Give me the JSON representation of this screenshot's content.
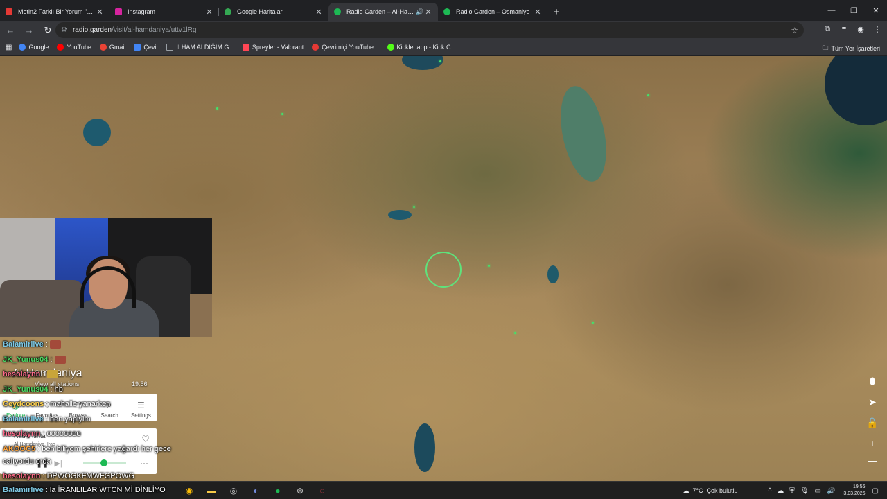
{
  "tabs": [
    {
      "title": "Metin2 Farklı Bir Yorum \"Hadi G",
      "favicon_color": "#e53935",
      "active": false
    },
    {
      "title": "Instagram",
      "favicon_color": "#d6249f",
      "active": false
    },
    {
      "title": "Google Haritalar",
      "favicon_color": "#34a853",
      "active": false
    },
    {
      "title": "Radio Garden – Al-Hamdan",
      "favicon_color": "#1db954",
      "active": true
    },
    {
      "title": "Radio Garden – Osmaniye",
      "favicon_color": "#1db954",
      "active": false
    }
  ],
  "address": {
    "host": "radio.garden",
    "path": "/visit/al-hamdaniya/uttv1lRg"
  },
  "bookmarks": [
    {
      "label": "Google",
      "color": "#4285f4"
    },
    {
      "label": "YouTube",
      "color": "#ff0000"
    },
    {
      "label": "Gmail",
      "color": "#ea4335"
    },
    {
      "label": "Çevir",
      "color": "#4285f4"
    },
    {
      "label": "İLHAM ALDIĞIM G...",
      "color": "#9aa0a6"
    },
    {
      "label": "Spreyler - Valorant",
      "color": "#ff4655"
    },
    {
      "label": "Çevrimiçi YouTube...",
      "color": "#e53935"
    },
    {
      "label": "Kicklet.app - Kick C...",
      "color": "#53fc18"
    }
  ],
  "bookmarks_right": "Tüm Yer İşaretleri",
  "radio": {
    "station_title": "Al-Hamdaniya",
    "view_all": "View all stations",
    "time": "19:56",
    "nav": [
      "Explore",
      "Favorites",
      "Browse",
      "Search",
      "Settings"
    ],
    "now_playing_station": "Radio Ishtar",
    "now_playing_location": "Al-Hamdaniya, Iraq"
  },
  "chat": [
    {
      "user": "Balamirlive",
      "color": "#7ec8e3",
      "msg": ":",
      "emote": true
    },
    {
      "user": "JK_Yunus04",
      "color": "#4cd964",
      "msg": ":",
      "emote": true
    },
    {
      "user": "hesolaynn",
      "color": "#ff6b8b",
      "msg": ":",
      "emote": true
    },
    {
      "user": "JK_Yunus04",
      "color": "#4cd964",
      "msg": ": hb",
      "emote": false
    },
    {
      "user": "Ceydcoons",
      "color": "#ffd24d",
      "msg": ": mahalle yanarken",
      "emote": false
    },
    {
      "user": "Balamirlive",
      "color": "#7ec8e3",
      "msg": ": ben yapiyim",
      "emote": false
    },
    {
      "user": "hesolaynn",
      "color": "#ff6b8b",
      "msg": ": oooooooo",
      "emote": false
    },
    {
      "user": "AKOOC5",
      "color": "#ffa53d",
      "msg": ": ben biliyom şehirlere yağardı her gece",
      "emote": false
    },
    {
      "user": "",
      "color": "#ffffff",
      "msg": "calıyordu orda",
      "emote": false
    },
    {
      "user": "hesolaynn",
      "color": "#ff6b8b",
      "msg": ": DPWOGKFMWFGPOWG",
      "emote": false
    },
    {
      "user": "Balamirlive",
      "color": "#7ec8e3",
      "msg": ": la İRANLILAR WTCN Mİ DİNLİYO",
      "emote": false
    }
  ],
  "taskbar": {
    "weather_temp": "7°C",
    "weather_text": "Çok bulutlu",
    "time": "19:56",
    "date": "3.03.2026"
  }
}
